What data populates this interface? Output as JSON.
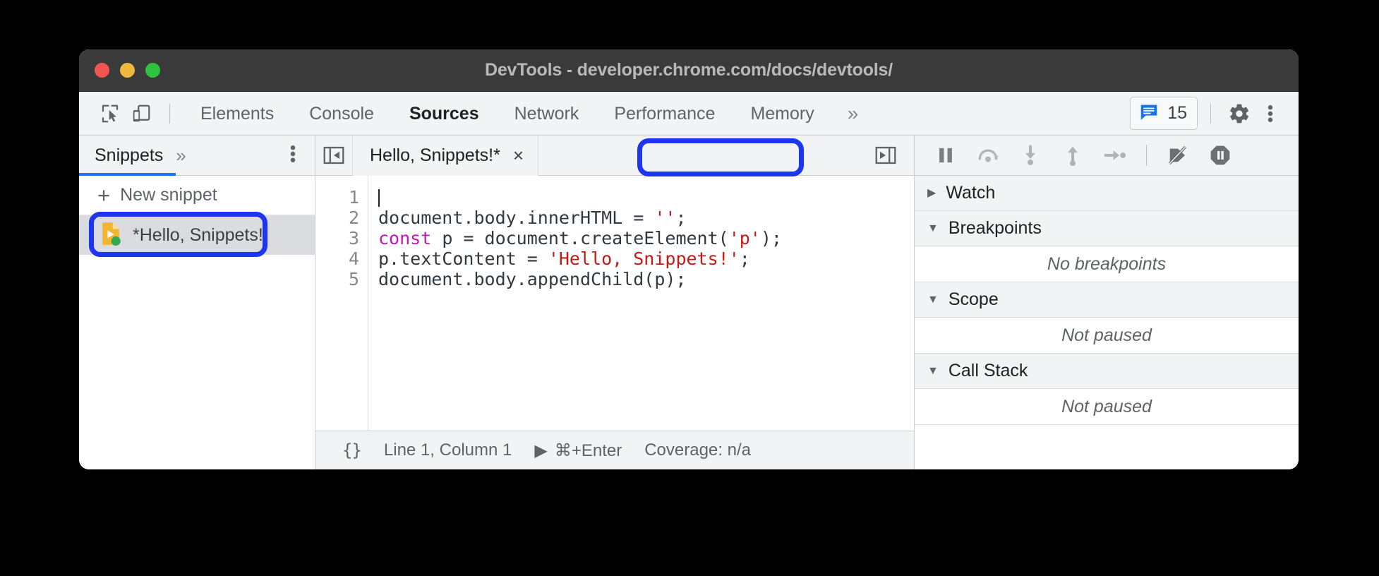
{
  "window": {
    "title": "DevTools - developer.chrome.com/docs/devtools/",
    "traffic_lights": [
      "close-red",
      "minimize-yellow",
      "maximize-green"
    ]
  },
  "main_toolbar": {
    "inspect_icon": "inspect-cursor-icon",
    "device_toolbar_icon": "device-toolbar-icon",
    "tabs": [
      {
        "label": "Elements",
        "active": false
      },
      {
        "label": "Console",
        "active": false
      },
      {
        "label": "Sources",
        "active": true
      },
      {
        "label": "Network",
        "active": false
      },
      {
        "label": "Performance",
        "active": false
      },
      {
        "label": "Memory",
        "active": false
      }
    ],
    "more_tabs_icon": "»",
    "issues": {
      "icon": "issues-message-icon",
      "count": "15",
      "color": "#1a73e8"
    },
    "settings_icon": "gear-icon",
    "more_options_icon": "vertical-dots-icon"
  },
  "navigator": {
    "tab_label": "Snippets",
    "more_tabs_icon": "»",
    "menu_icon": "vertical-dots-icon",
    "new_snippet_label": "New snippet",
    "new_snippet_plus": "+",
    "items": [
      {
        "label": "*Hello, Snippets!",
        "icon": "snippet-script-file-icon",
        "icon_color": "#f2b530",
        "badge_color": "#34a853",
        "selected": true,
        "annotated": true
      }
    ]
  },
  "editor": {
    "collapse_navigator_icon": "show-navigator-panel-icon",
    "show_debugger_icon": "show-debugger-panel-icon",
    "tab": {
      "title": "Hello, Snippets!*",
      "close_icon": "×",
      "annotated": true
    },
    "line_numbers": [
      "1",
      "2",
      "3",
      "4",
      "5"
    ],
    "code_lines": [
      [
        {
          "t": "",
          "c": "plain"
        }
      ],
      [
        {
          "t": "document.body.innerHTML = ",
          "c": "plain"
        },
        {
          "t": "''",
          "c": "string"
        },
        {
          "t": ";",
          "c": "plain"
        }
      ],
      [
        {
          "t": "const",
          "c": "keyword"
        },
        {
          "t": " p = document.createElement(",
          "c": "plain"
        },
        {
          "t": "'p'",
          "c": "string"
        },
        {
          "t": ");",
          "c": "plain"
        }
      ],
      [
        {
          "t": "p.textContent = ",
          "c": "plain"
        },
        {
          "t": "'Hello, Snippets!'",
          "c": "string"
        },
        {
          "t": ";",
          "c": "plain"
        }
      ],
      [
        {
          "t": "document.body.appendChild(p);",
          "c": "plain"
        }
      ]
    ],
    "statusbar": {
      "pretty_print_label": "{}",
      "cursor_position": "Line 1, Column 1",
      "run_icon": "▶",
      "run_shortcut": "⌘+Enter",
      "coverage": "Coverage: n/a"
    }
  },
  "debugger": {
    "toolbar_buttons": [
      {
        "name": "pause-resume-script",
        "icon": "pause-icon"
      },
      {
        "name": "step-over",
        "icon": "step-over-icon"
      },
      {
        "name": "step-into",
        "icon": "step-into-icon"
      },
      {
        "name": "step-out",
        "icon": "step-out-icon"
      },
      {
        "name": "step",
        "icon": "step-icon"
      },
      {
        "name": "deactivate-breakpoints",
        "icon": "deactivate-breakpoints-icon"
      },
      {
        "name": "pause-on-exceptions",
        "icon": "pause-on-exceptions-icon"
      }
    ],
    "sections": [
      {
        "title": "Watch",
        "expanded": false,
        "empty_text": null
      },
      {
        "title": "Breakpoints",
        "expanded": true,
        "empty_text": "No breakpoints"
      },
      {
        "title": "Scope",
        "expanded": true,
        "empty_text": "Not paused"
      },
      {
        "title": "Call Stack",
        "expanded": true,
        "empty_text": "Not paused"
      }
    ],
    "triangle_collapsed": "▶",
    "triangle_expanded": "▼"
  },
  "annotation": {
    "color": "#1b35f0",
    "label": "highlight-ring"
  }
}
